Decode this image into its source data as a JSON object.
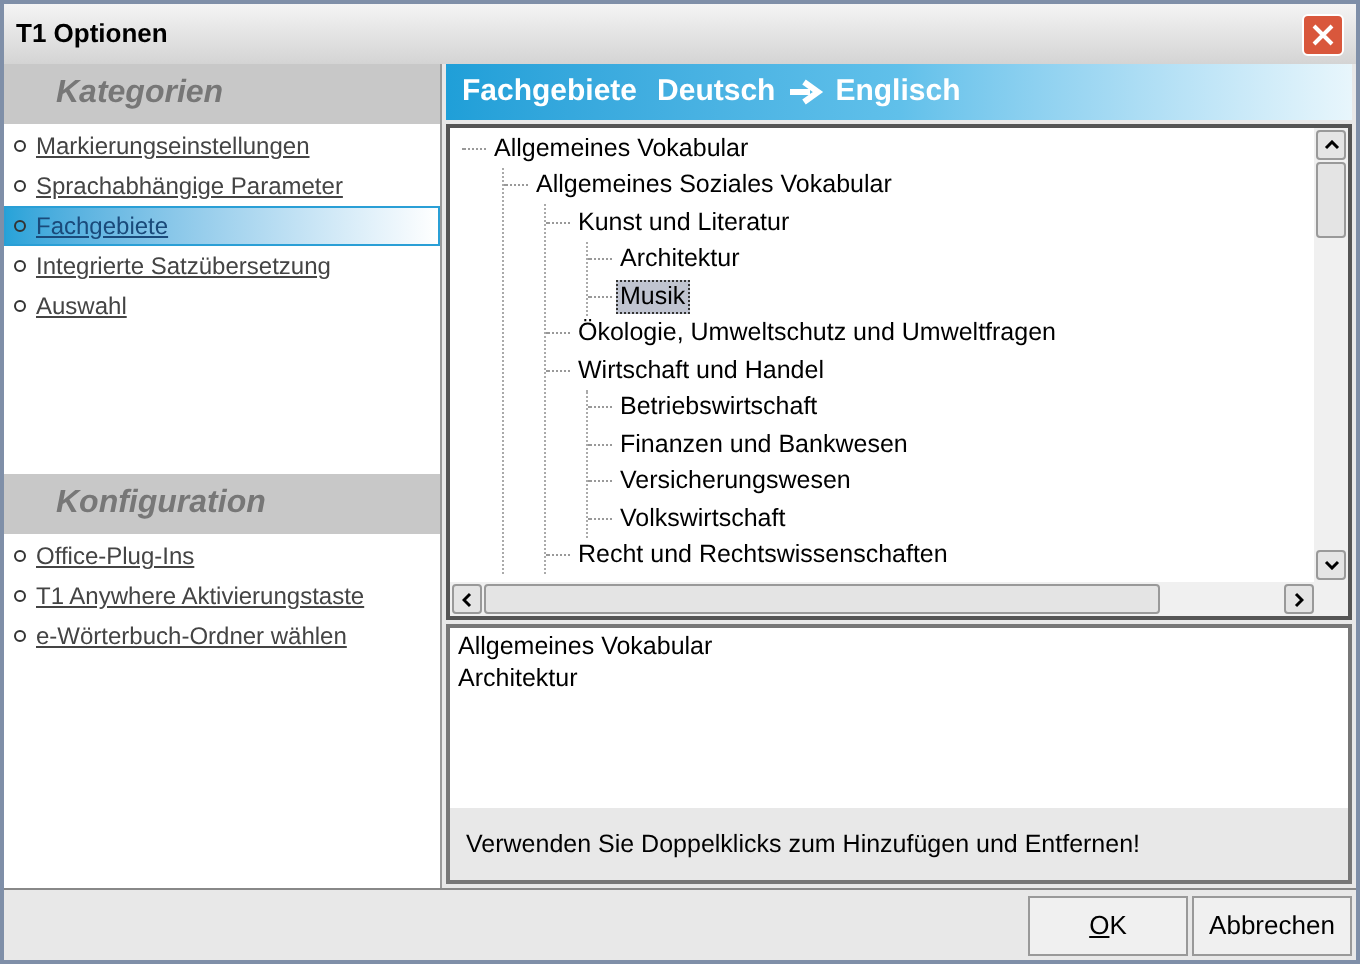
{
  "window": {
    "title": "T1 Optionen"
  },
  "sidebar": {
    "sections": [
      {
        "title": "Kategorien",
        "items": [
          {
            "label": "Markierungseinstellungen",
            "selected": false
          },
          {
            "label": "Sprachabhängige Parameter",
            "selected": false
          },
          {
            "label": "Fachgebiete",
            "selected": true
          },
          {
            "label": "Integrierte Satzübersetzung",
            "selected": false
          },
          {
            "label": "Auswahl",
            "selected": false
          }
        ]
      },
      {
        "title": "Konfiguration",
        "items": [
          {
            "label": "Office-Plug-Ins",
            "selected": false
          },
          {
            "label": "T1 Anywhere Aktivierungstaste",
            "selected": false
          },
          {
            "label": "e-Wörterbuch-Ordner wählen",
            "selected": false
          }
        ]
      }
    ]
  },
  "panel": {
    "title": "Fachgebiete",
    "source": "Deutsch",
    "target": "Englisch",
    "tree": [
      {
        "label": "Allgemeines Vokabular",
        "selected": false,
        "children": [
          {
            "label": "Allgemeines Soziales Vokabular",
            "selected": false,
            "children": [
              {
                "label": "Kunst und Literatur",
                "selected": false,
                "children": [
                  {
                    "label": "Architektur",
                    "selected": false
                  },
                  {
                    "label": "Musik",
                    "selected": true
                  }
                ]
              },
              {
                "label": "Ökologie, Umweltschutz und Umweltfragen",
                "selected": false
              },
              {
                "label": "Wirtschaft und Handel",
                "selected": false,
                "children": [
                  {
                    "label": "Betriebswirtschaft",
                    "selected": false
                  },
                  {
                    "label": "Finanzen und Bankwesen",
                    "selected": false
                  },
                  {
                    "label": "Versicherungswesen",
                    "selected": false
                  },
                  {
                    "label": "Volkswirtschaft",
                    "selected": false
                  }
                ]
              },
              {
                "label": "Recht und Rechtswissenschaften",
                "selected": false
              }
            ]
          }
        ]
      }
    ],
    "chosen": [
      "Allgemeines Vokabular",
      "Architektur"
    ],
    "hint": "Verwenden Sie Doppelklicks zum Hinzufügen und Entfernen!"
  },
  "buttons": [
    {
      "label": "OK",
      "mnemonic": true
    },
    {
      "label": "Abbrechen"
    }
  ]
}
